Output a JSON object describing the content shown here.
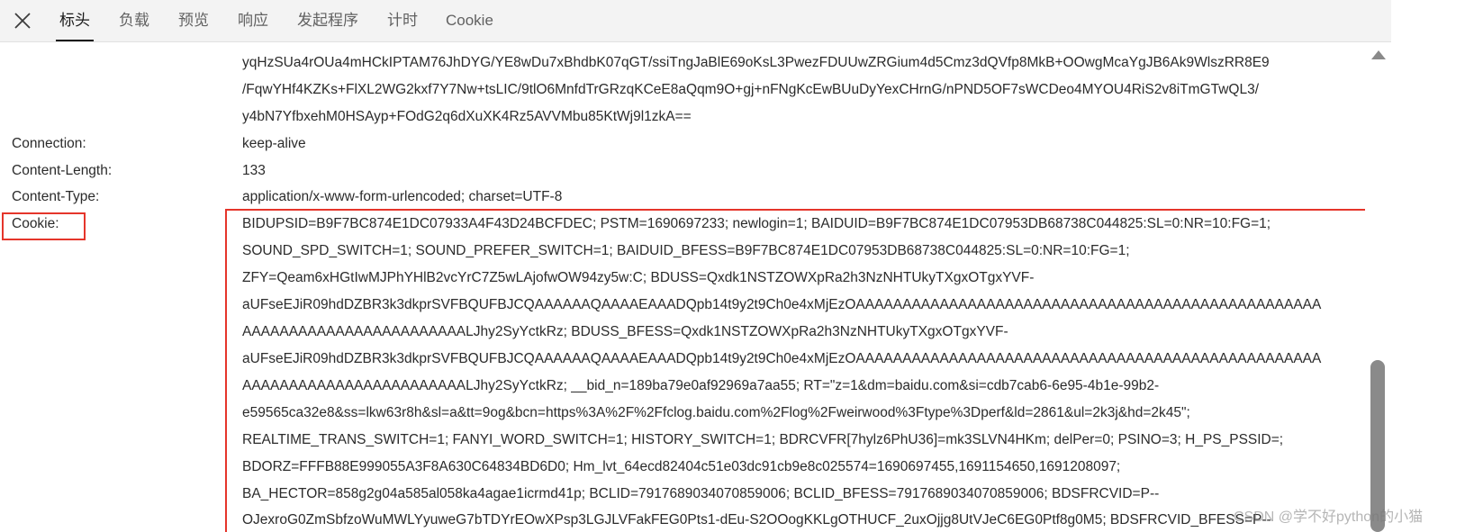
{
  "tabs": [
    {
      "label": "标头",
      "active": true
    },
    {
      "label": "负载",
      "active": false
    },
    {
      "label": "预览",
      "active": false
    },
    {
      "label": "响应",
      "active": false
    },
    {
      "label": "发起程序",
      "active": false
    },
    {
      "label": "计时",
      "active": false
    },
    {
      "label": "Cookie",
      "active": false
    }
  ],
  "prev_value_lines": [
    "yqHzSUa4rOUa4mHCkIPTAM76JhDYG/YE8wDu7xBhdbK07qGT/ssiTngJaBlE69oKsL3PwezFDUUwZRGium4d5Cmz3dQVfp8MkB+OOwgMcaYgJB6Ak9WlszRR8E9",
    "/FqwYHf4KZKs+FlXL2WG2kxf7Y7Nw+tsLIC/9tlO6MnfdTrGRzqKCeE8aQqm9O+gj+nFNgKcEwBUuDyYexCHrnG/nPND5OF7sWCDeo4MYOU4RiS2v8iTmGTwQL3/",
    "y4bN7YfbxehM0HSAyp+FOdG2q6dXuXK4Rz5AVVMbu85KtWj9l1zkA=="
  ],
  "headers": [
    {
      "name": "Connection:",
      "value": "keep-alive"
    },
    {
      "name": "Content-Length:",
      "value": "133"
    },
    {
      "name": "Content-Type:",
      "value": "application/x-www-form-urlencoded; charset=UTF-8"
    }
  ],
  "cookie": {
    "name": "Cookie:",
    "lines": [
      "BIDUPSID=B9F7BC874E1DC07933A4F43D24BCFDEC; PSTM=1690697233; newlogin=1; BAIDUID=B9F7BC874E1DC07953DB68738C044825:SL=0:NR=10:FG=1;",
      "SOUND_SPD_SWITCH=1; SOUND_PREFER_SWITCH=1; BAIDUID_BFESS=B9F7BC874E1DC07953DB68738C044825:SL=0:NR=10:FG=1;",
      "ZFY=Qeam6xHGtIwMJPhYHlB2vcYrC7Z5wLAjofwOW94zy5w:C; BDUSS=Qxdk1NSTZOWXpRa2h3NzNHTUkyTXgxOTgxYVF-",
      "aUFseEJiR09hdDZBR3k3dkprSVFBQUFBJCQAAAAAAQAAAAEAAADQpb14t9y2t9Ch0e4xMjEzOAAAAAAAAAAAAAAAAAAAAAAAAAAAAAAAAAAAAAAAAAAAAAAAAAA",
      "AAAAAAAAAAAAAAAAAAAAAAAALJhy2SyYctkRz; BDUSS_BFESS=Qxdk1NSTZOWXpRa2h3NzNHTUkyTXgxOTgxYVF-",
      "aUFseEJiR09hdDZBR3k3dkprSVFBQUFBJCQAAAAAAQAAAAEAAADQpb14t9y2t9Ch0e4xMjEzOAAAAAAAAAAAAAAAAAAAAAAAAAAAAAAAAAAAAAAAAAAAAAAAAAA",
      "AAAAAAAAAAAAAAAAAAAAAAAALJhy2SyYctkRz; __bid_n=189ba79e0af92969a7aa55; RT=\"z=1&dm=baidu.com&si=cdb7cab6-6e95-4b1e-99b2-",
      "e59565ca32e8&ss=lkw63r8h&sl=a&tt=9og&bcn=https%3A%2F%2Ffclog.baidu.com%2Flog%2Fweirwood%3Ftype%3Dperf&ld=2861&ul=2k3j&hd=2k45\";",
      "REALTIME_TRANS_SWITCH=1; FANYI_WORD_SWITCH=1; HISTORY_SWITCH=1; BDRCVFR[7hylz6PhU36]=mk3SLVN4HKm; delPer=0; PSINO=3; H_PS_PSSID=;",
      "BDORZ=FFFB88E999055A3F8A630C64834BD6D0; Hm_lvt_64ecd82404c51e03dc91cb9e8c025574=1690697455,1691154650,1691208097;",
      "BA_HECTOR=858g2g04a585al058ka4agae1icrmd41p; BCLID=7917689034070859006; BCLID_BFESS=7917689034070859006; BDSFRCVID=P--",
      "OJexroG0ZmSbfzoWuMWLYyuweG7bTDYrEOwXPsp3LGJLVFakFEG0Pts1-dEu-S2OOogKKLgOTHUCF_2uxOjjg8UtVJeC6EG0Ptf8g0M5; BDSFRCVID_BFESS=P--"
    ]
  },
  "watermark": "CSDN @学不好python的小猫",
  "colors": {
    "highlight": "#e5352b",
    "tabbar_bg": "#f3f3f3",
    "scroll_thumb": "#8a8a8a"
  }
}
